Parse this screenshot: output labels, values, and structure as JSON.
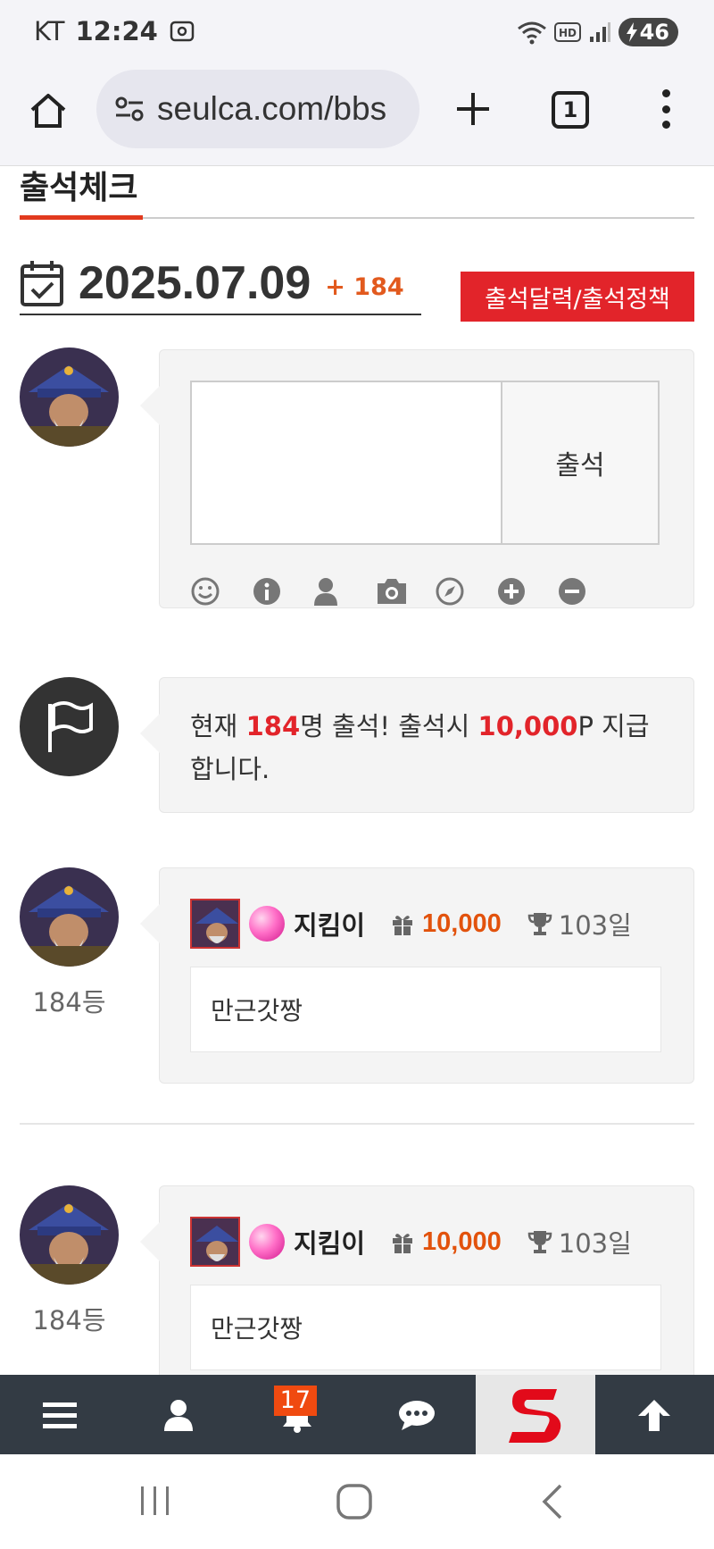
{
  "status_bar": {
    "carrier": "KT",
    "time": "12:24",
    "battery": "46"
  },
  "browser": {
    "url": "seulca.com/bbs",
    "tab_count": "1"
  },
  "page": {
    "section_title": "출석체크",
    "date": "2025.07.09",
    "date_count": "+ 184",
    "calendar_button": "출석달력/출석정책"
  },
  "write": {
    "submit_label": "출석",
    "tools": [
      "smile-icon",
      "info-icon",
      "user-icon",
      "camera-icon",
      "compass-icon",
      "plus-circle-icon",
      "minus-circle-icon"
    ]
  },
  "notice": {
    "prefix": "현재 ",
    "count": "184",
    "mid": "명 출석! 출석시 ",
    "points": "10,000",
    "suffix": "P 지급합니다."
  },
  "entries": [
    {
      "rank": "184등",
      "nickname": "지킴이",
      "points": "10,000",
      "days": "103일",
      "comment": "만근갓짱"
    },
    {
      "rank": "184등",
      "nickname": "지킴이",
      "points": "10,000",
      "days": "103일",
      "comment": "만근갓짱"
    }
  ],
  "bottom_nav": {
    "notification_count": "17"
  },
  "colors": {
    "accent_red": "#e2242a",
    "points_orange": "#e2520c",
    "bottom_bar": "#333b44"
  }
}
